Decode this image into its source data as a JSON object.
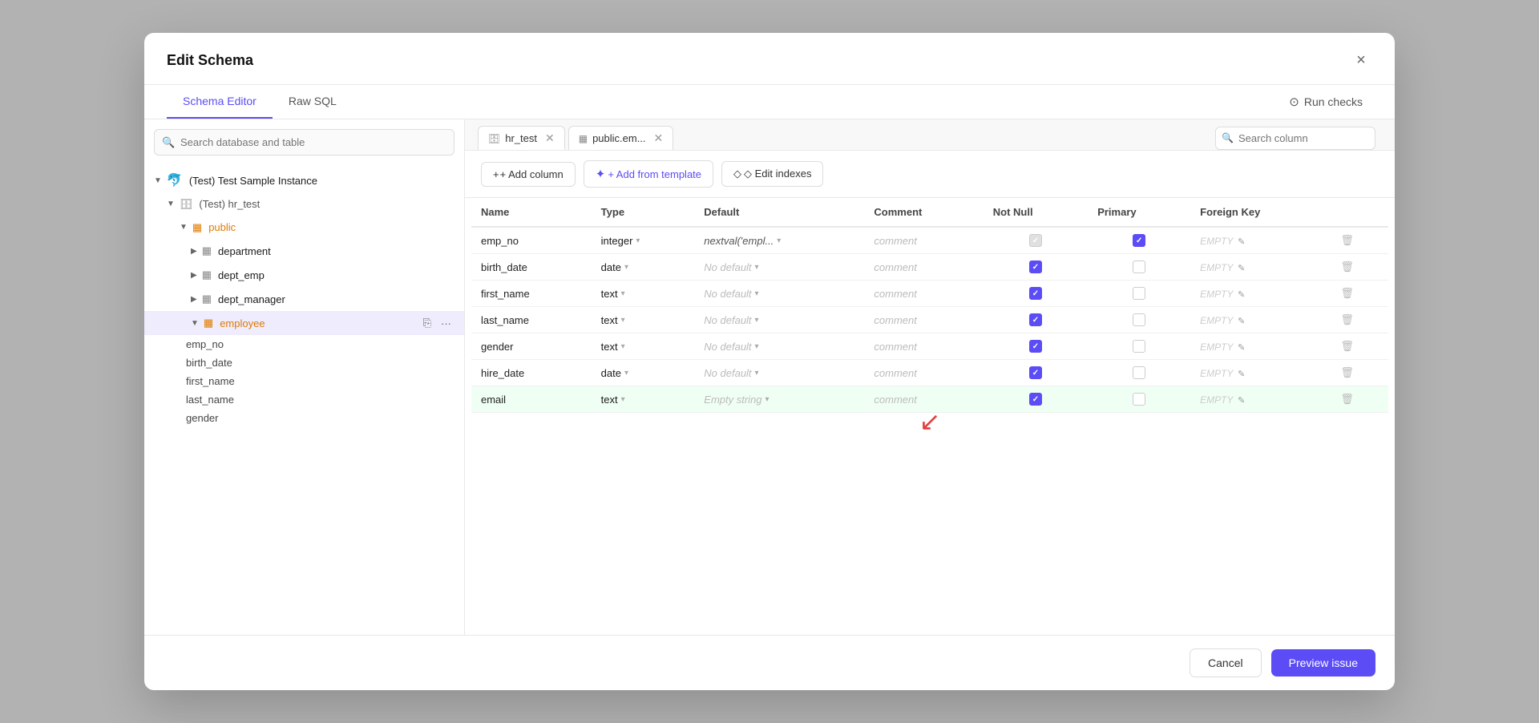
{
  "modal": {
    "title": "Edit Schema",
    "close_label": "×"
  },
  "tabs": {
    "schema_editor": "Schema Editor",
    "raw_sql": "Raw SQL",
    "active": "Schema Editor"
  },
  "run_checks": {
    "label": "Run checks"
  },
  "sidebar": {
    "search_placeholder": "Search database and table",
    "tree": [
      {
        "id": "instance",
        "label": "(Test) Test Sample Instance",
        "icon": "instance",
        "level": 0,
        "expanded": true
      },
      {
        "id": "hr_test",
        "label": "(Test) hr_test",
        "icon": "database",
        "level": 1,
        "expanded": true
      },
      {
        "id": "public",
        "label": "public",
        "icon": "schema",
        "level": 2,
        "expanded": true,
        "color": "orange"
      },
      {
        "id": "department",
        "label": "department",
        "icon": "table",
        "level": 3
      },
      {
        "id": "dept_emp",
        "label": "dept_emp",
        "icon": "table",
        "level": 3
      },
      {
        "id": "dept_manager",
        "label": "dept_manager",
        "icon": "table",
        "level": 3
      },
      {
        "id": "employee",
        "label": "employee",
        "icon": "table",
        "level": 3,
        "selected": true,
        "color": "orange"
      }
    ],
    "fields": [
      "emp_no",
      "birth_date",
      "first_name",
      "last_name",
      "gender"
    ]
  },
  "table_tabs": [
    {
      "id": "hr_test",
      "label": "hr_test",
      "icon": "db",
      "closable": true
    },
    {
      "id": "public_em",
      "label": "public.em...",
      "icon": "table",
      "closable": true,
      "active": true
    }
  ],
  "search_column": {
    "placeholder": "Search column"
  },
  "toolbar": {
    "add_column": "+ Add column",
    "add_template": "+ Add from template",
    "edit_indexes": "◇ Edit indexes"
  },
  "columns": {
    "headers": [
      "Name",
      "Type",
      "Default",
      "Comment",
      "Not Null",
      "Primary",
      "Foreign Key"
    ],
    "rows": [
      {
        "name": "emp_no",
        "type": "integer",
        "default": "nextval('empl...",
        "comment": "comment",
        "not_null": "gray",
        "primary": true,
        "fk": "EMPTY",
        "highlighted": false
      },
      {
        "name": "birth_date",
        "type": "date",
        "default": "No default",
        "comment": "comment",
        "not_null": true,
        "primary": false,
        "fk": "EMPTY",
        "highlighted": false
      },
      {
        "name": "first_name",
        "type": "text",
        "default": "No default",
        "comment": "comment",
        "not_null": true,
        "primary": false,
        "fk": "EMPTY",
        "highlighted": false
      },
      {
        "name": "last_name",
        "type": "text",
        "default": "No default",
        "comment": "comment",
        "not_null": true,
        "primary": false,
        "fk": "EMPTY",
        "highlighted": false
      },
      {
        "name": "gender",
        "type": "text",
        "default": "No default",
        "comment": "comment",
        "not_null": true,
        "primary": false,
        "fk": "EMPTY",
        "highlighted": false
      },
      {
        "name": "hire_date",
        "type": "date",
        "default": "No default",
        "comment": "comment",
        "not_null": true,
        "primary": false,
        "fk": "EMPTY",
        "highlighted": false
      },
      {
        "name": "email",
        "type": "text",
        "default": "Empty string",
        "comment": "comment",
        "not_null": true,
        "primary": false,
        "fk": "EMPTY",
        "highlighted": true
      }
    ]
  },
  "footer": {
    "cancel_label": "Cancel",
    "preview_label": "Preview issue"
  },
  "colors": {
    "accent": "#5b4cf5",
    "orange": "#e07b00",
    "red_arrow": "#e53e3e",
    "highlight_row": "#f0fff4"
  }
}
